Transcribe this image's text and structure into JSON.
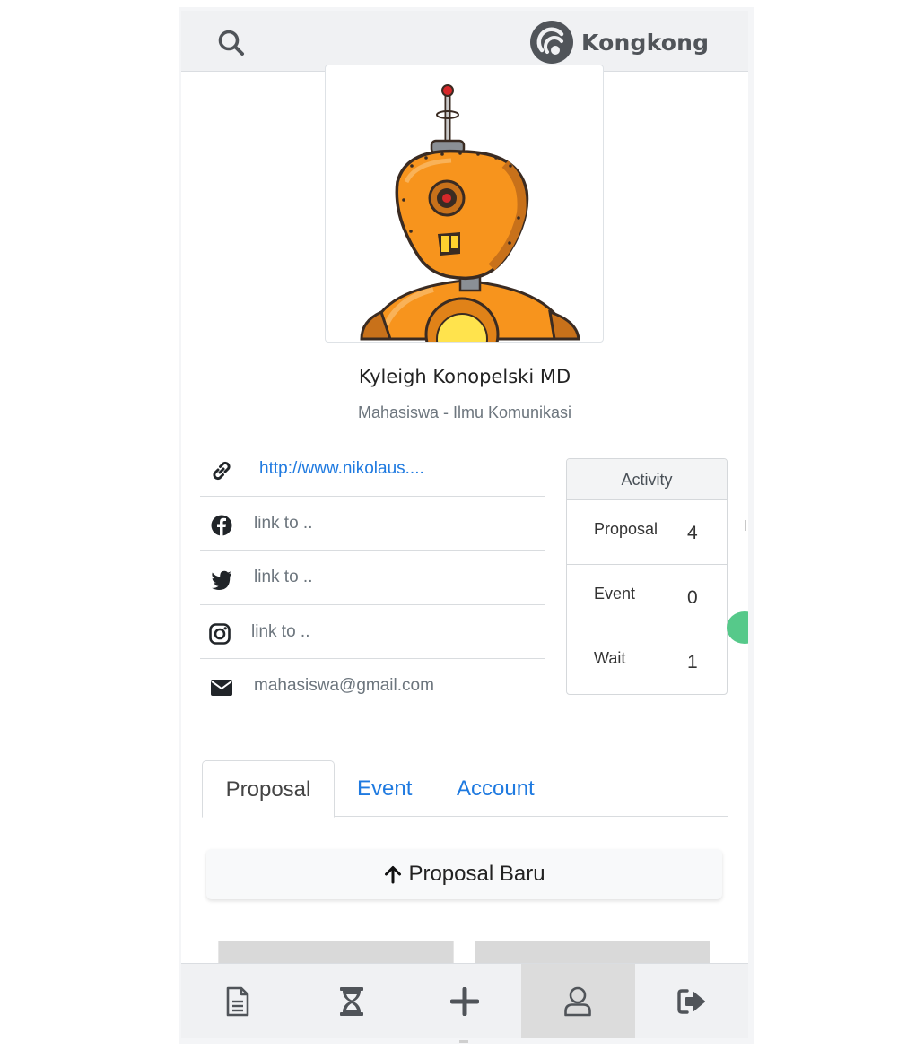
{
  "header": {
    "brand_name": "Kongkong",
    "search_icon": "search-icon",
    "logo_icon": "kongkong-logo"
  },
  "profile": {
    "name": "Kyleigh Konopelski MD",
    "role": "Mahasiswa - Ilmu Komunikasi",
    "avatar": "orange-robot-avatar"
  },
  "contacts": [
    {
      "icon": "link-icon",
      "text": "http://www.nikolaus...."
    },
    {
      "icon": "facebook-icon",
      "text": "link to .."
    },
    {
      "icon": "twitter-icon",
      "text": "link to .."
    },
    {
      "icon": "instagram-icon",
      "text": "link to .."
    },
    {
      "icon": "envelope-icon",
      "text": "mahasiswa@gmail.com"
    }
  ],
  "activity": {
    "title": "Activity",
    "rows": [
      {
        "label": "Proposal",
        "value": "4"
      },
      {
        "label": "Event",
        "value": "0"
      },
      {
        "label": "Wait",
        "value": "1"
      }
    ]
  },
  "tabs": [
    {
      "label": "Proposal",
      "active": true
    },
    {
      "label": "Event",
      "active": false
    },
    {
      "label": "Account",
      "active": false
    }
  ],
  "new_proposal_button": {
    "label": "Proposal Baru",
    "icon": "arrow-up-icon"
  },
  "bottom_nav": [
    {
      "icon": "document-icon",
      "active": false
    },
    {
      "icon": "hourglass-icon",
      "active": false
    },
    {
      "icon": "plus-icon",
      "active": false
    },
    {
      "icon": "user-icon",
      "active": true
    },
    {
      "icon": "sign-out-icon",
      "active": false
    }
  ],
  "colors": {
    "accent": "#1f7ae0",
    "header_bg": "#f0f1f3",
    "robot_orange": "#f7941d",
    "status_dot": "#56c98a"
  }
}
